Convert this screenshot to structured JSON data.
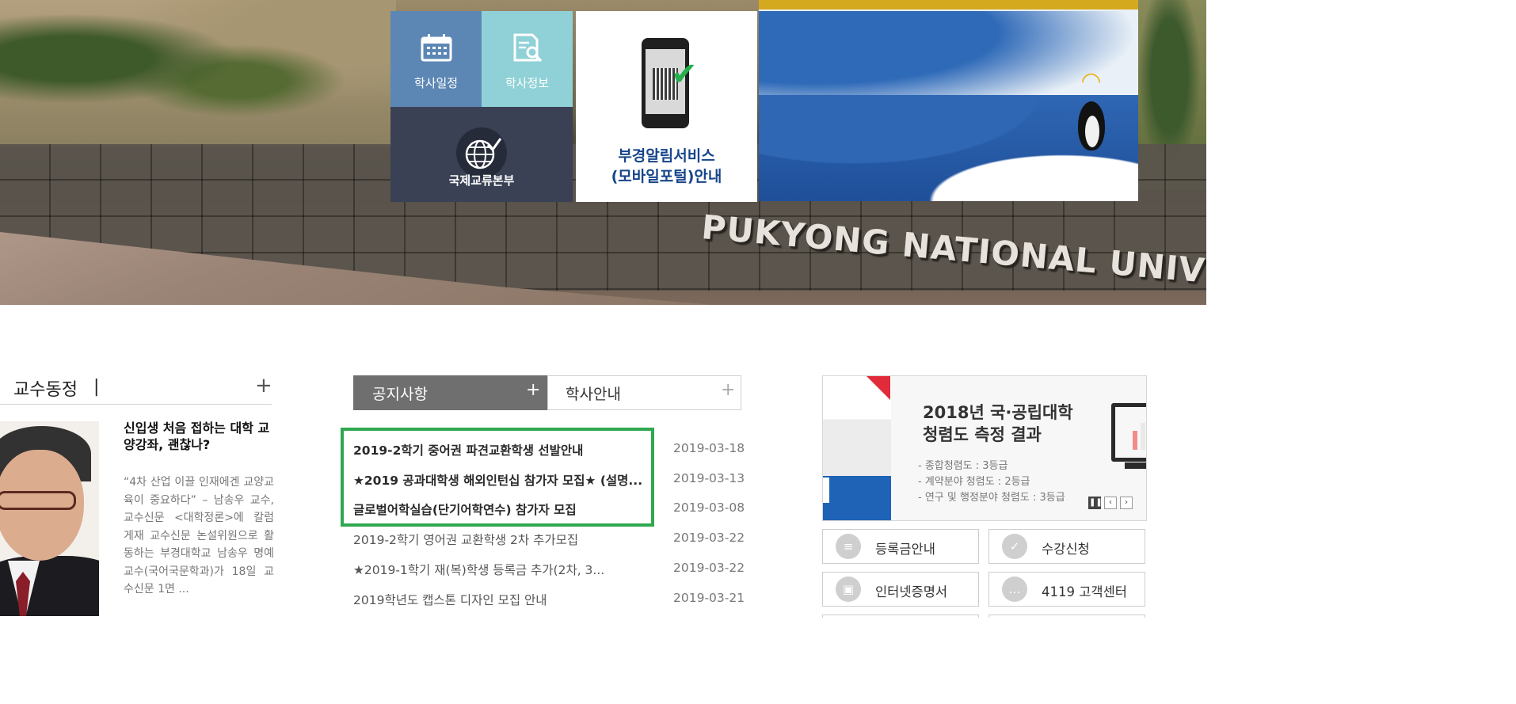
{
  "hero": {
    "sign_text": "PUKYONG NATIONAL UNIVERSITY"
  },
  "quick_tiles": {
    "schedule_label": "학사일정",
    "info_label": "학사정보",
    "intl_label": "국제교류본부"
  },
  "mobile_card": {
    "line1": "부경알림서비스",
    "line2": "(모바일포털)안내"
  },
  "professor_news": {
    "section_title": "교수동정",
    "more_label": "+",
    "headline": "신입생 처음 접하는 대학 교양강좌, 괜찮나?",
    "summary": "“4차 산업 이끌 인재에겐 교양교육이 중요하다” – 남송우 교수, 교수신문 <대학정론>에 칼럼 게재 교수신문 논설위원으로 활동하는 부경대학교 남송우 명예교수(국어국문학과)가 18일 교수신문 1면 ..."
  },
  "notices": {
    "tabs": [
      {
        "label": "공지사항",
        "plus": "+"
      },
      {
        "label": "학사안내",
        "plus": "+"
      }
    ],
    "items": [
      {
        "title": "2019-2학기 중어권 파견교환학생 선발안내",
        "date": "2019-03-18",
        "bold": true
      },
      {
        "title": "★2019 공과대학생 해외인턴십 참가자 모집★ (설명...",
        "date": "2019-03-13",
        "bold": true
      },
      {
        "title": "글로벌어학실습(단기어학연수) 참가자 모집",
        "date": "2019-03-08",
        "bold": true
      },
      {
        "title": "2019-2학기 영어권 교환학생 2차 추가모집",
        "date": "2019-03-22",
        "bold": false
      },
      {
        "title": "★2019-1학기 재(복)학생 등록금 추가(2차, 3...",
        "date": "2019-03-22",
        "bold": false
      },
      {
        "title": "2019학년도 캡스톤 디자인 모집 안내",
        "date": "2019-03-21",
        "bold": false
      }
    ]
  },
  "integrity_banner": {
    "title_line1": "2018년 국·공립대학",
    "title_line2": "청렴도 측정 결과",
    "items": [
      "- 종합청렴도 : 3등급",
      "- 계약분야 청렴도 : 2등급",
      "- 연구 및 행정분야 청렴도 : 3등급"
    ],
    "controls": {
      "pause": "❚❚",
      "prev": "‹",
      "next": "›"
    }
  },
  "quick_links": {
    "tuition": "등록금안내",
    "course": "수강신청",
    "certificate": "인터넷증명서",
    "center": "4119 고객센터"
  },
  "colors": {
    "notice_tab_active": "#6f6f6f",
    "highlight_border": "#2fa84f",
    "mobile_text": "#17458a",
    "tile_schedule": "#5c87b4",
    "tile_info": "#8fd1d6",
    "tile_intl": "#3a4155"
  }
}
